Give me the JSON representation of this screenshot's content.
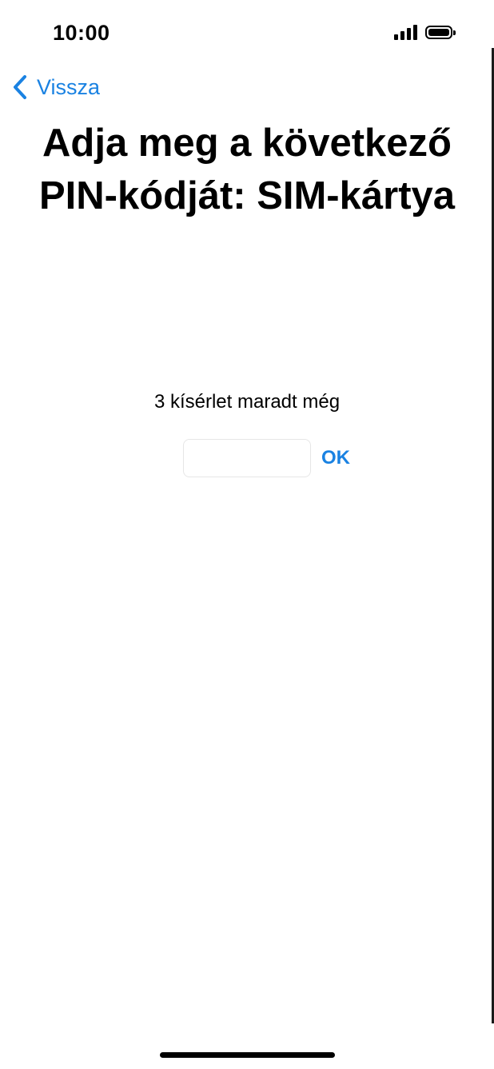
{
  "status_bar": {
    "time": "10:00",
    "signal_icon": "cellular-signal-icon",
    "battery_icon": "battery-icon"
  },
  "nav": {
    "back_label": "Vissza",
    "back_icon": "chevron-left-icon"
  },
  "title": "Adja meg a következő PIN-kódját: SIM-kártya",
  "attempts_text": "3 kísérlet maradt még",
  "pin_field": {
    "value": "",
    "placeholder": ""
  },
  "ok_label": "OK",
  "colors": {
    "accent": "#1a82e2",
    "background": "#ffffff",
    "text": "#000000"
  }
}
